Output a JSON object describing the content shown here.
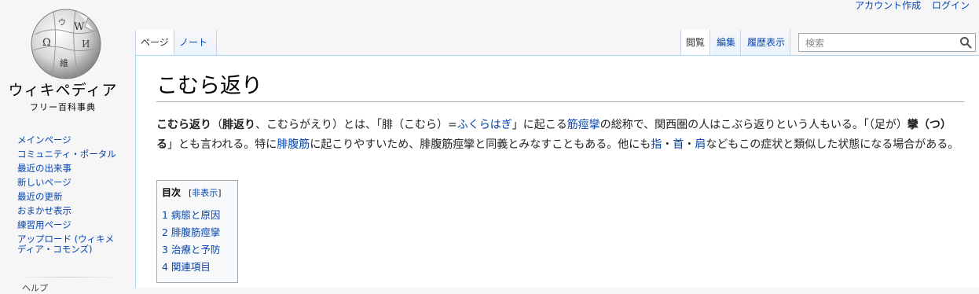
{
  "personal_tools": {
    "create_account": "アカウント作成",
    "login": "ログイン"
  },
  "logo": {
    "title": "ウィキペディア",
    "subtitle": "フリー百科事典",
    "glyphs": [
      "W",
      "Ω",
      "維",
      "И",
      "ウ"
    ]
  },
  "sidebar": {
    "items": [
      {
        "label": "メインページ"
      },
      {
        "label": "コミュニティ・ポータル"
      },
      {
        "label": "最近の出来事"
      },
      {
        "label": "新しいページ"
      },
      {
        "label": "最近の更新"
      },
      {
        "label": "おまかせ表示"
      },
      {
        "label": "練習用ページ"
      },
      {
        "label": "アップロード (ウィキメディア・コモンズ)"
      }
    ],
    "next_heading": "ヘルプ"
  },
  "tabs": {
    "page": "ページ",
    "talk": "ノート",
    "read": "閲覧",
    "edit": "編集",
    "history": "履歴表示"
  },
  "search": {
    "placeholder": "検索",
    "icon": "search-icon"
  },
  "article": {
    "title": "こむら返り",
    "intro": {
      "t1": "こむら返り",
      "t2": "（",
      "t3": "腓返り",
      "t4": "、こむらがえり）とは、「腓（こむら）=",
      "link_fukurahagi": "ふくらはぎ",
      "t5": "」に起こる",
      "link_kinkeiren": "筋痙攣",
      "t6": "の総称で、関西圏の人はこぶら返りという人もいる。「（足が）",
      "t7": "攣（つ）る",
      "t8": "」とも言われる。特に",
      "link_hifukukin": "腓腹筋",
      "t9": "に起こりやすいため、腓腹筋痙攣と同義とみなすこともある。他にも",
      "link_yubi": "指",
      "sep1": "・",
      "link_kubi": "首",
      "sep2": "・",
      "link_kata": "肩",
      "t10": "などもこの症状と類似した状態になる場合がある。"
    }
  },
  "toc": {
    "title": "目次",
    "toggle_open": "[",
    "toggle_label": "非表示",
    "toggle_close": "]",
    "items": [
      {
        "label": "1 病態と原因"
      },
      {
        "label": "2 腓腹筋痙攣"
      },
      {
        "label": "3 治療と予防"
      },
      {
        "label": "4 関連項目"
      }
    ]
  }
}
